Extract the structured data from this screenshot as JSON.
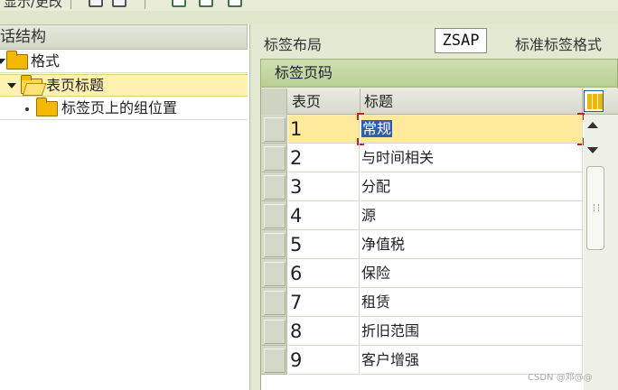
{
  "toolbar": {
    "truncated_text": "显示/更改",
    "icons": [
      "document-icon",
      "document-gear-icon",
      "create-icon",
      "edit-icon",
      "copy-icon"
    ]
  },
  "tree": {
    "header": "话结构",
    "items": [
      {
        "label": "格式",
        "level": 0,
        "expanded": true
      },
      {
        "label": "表页标题",
        "level": 1,
        "expanded": true,
        "selected": true
      },
      {
        "label": "标签页上的组位置",
        "level": 2,
        "expanded": false
      }
    ]
  },
  "layout": {
    "label": "标签布局",
    "value": "ZSAP",
    "description": "标准标签格式"
  },
  "panel": {
    "title": "标签页码",
    "columns": [
      "表页",
      "标题"
    ],
    "rows": [
      {
        "page": "1",
        "title": "常规"
      },
      {
        "page": "2",
        "title": "与时间相关"
      },
      {
        "page": "3",
        "title": "分配"
      },
      {
        "page": "4",
        "title": "源"
      },
      {
        "page": "5",
        "title": "净值税"
      },
      {
        "page": "6",
        "title": "保险"
      },
      {
        "page": "7",
        "title": "租赁"
      },
      {
        "page": "8",
        "title": "折旧范围"
      },
      {
        "page": "9",
        "title": "客户增强"
      }
    ],
    "active_row": 0
  },
  "colors": {
    "selection": "#fff2b0",
    "highlight": "#2e5eaa",
    "folder": "#f5b800",
    "panel_header": "#c4d8a2"
  },
  "watermark": "CSDN @邓@@"
}
